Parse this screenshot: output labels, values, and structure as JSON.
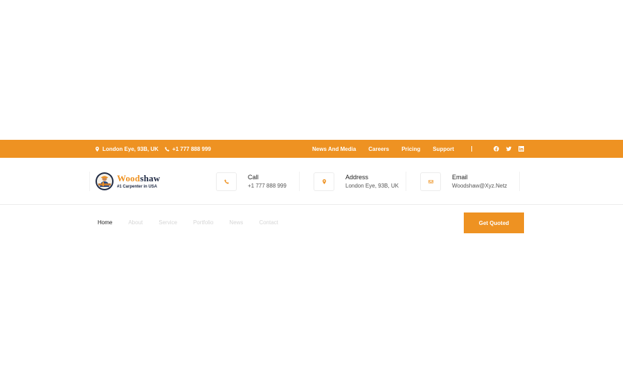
{
  "topbar": {
    "address": "London Eye, 93B, UK",
    "phone": "+1 777 888 999",
    "links": [
      "News And Media",
      "Careers",
      "Pricing",
      "Support"
    ],
    "social": [
      "facebook-icon",
      "twitter-icon",
      "linkedin-icon"
    ],
    "background": "#ee9222"
  },
  "logo": {
    "brand_part1": "Wood",
    "brand_part2": "shaw",
    "tagline": "#1 Carpenter in USA"
  },
  "contacts": {
    "call": {
      "label": "Call",
      "value": "+1 777 888 999",
      "icon": "phone-icon"
    },
    "address": {
      "label": "Address",
      "value": "London Eye, 93B, UK",
      "icon": "location-pin-icon"
    },
    "email": {
      "label": "Email",
      "value": "Woodshaw@Xyz.Netz",
      "icon": "envelope-icon"
    }
  },
  "nav": {
    "items": [
      "Home",
      "About",
      "Service",
      "Portfolio",
      "News",
      "Contact"
    ],
    "active": "Home"
  },
  "cta": {
    "label": "Get Quoted"
  },
  "colors": {
    "accent": "#ee9222",
    "dark": "#1f2a44"
  }
}
